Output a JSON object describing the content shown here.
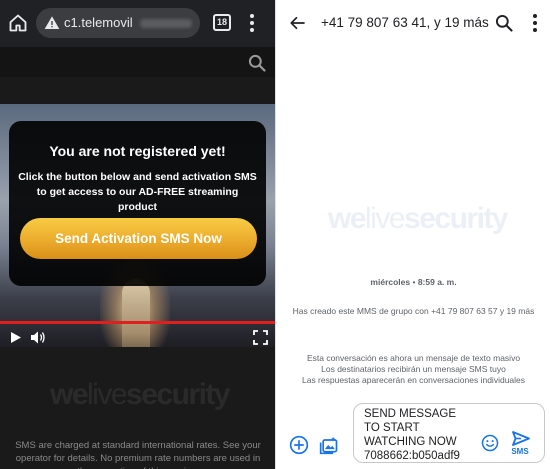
{
  "browser": {
    "url": "c1.telemovil",
    "tab_count": "18",
    "icons": {
      "home": "home-icon",
      "warning": "warning-icon",
      "menu": "more-vert-icon",
      "search": "search-icon"
    }
  },
  "modal": {
    "title": "You are not registered yet!",
    "body": "Click the button below and send activation SMS to get access to our AD-FREE streaming product",
    "button_label": "Send Activation SMS Now",
    "button_color": "#eaa82a"
  },
  "video": {
    "progress_color": "#e0201f",
    "icons": {
      "play": "play-icon",
      "volume": "volume-icon",
      "fullscreen": "fullscreen-icon"
    }
  },
  "disclaimer": "SMS are charged at standard international rates. See your operator for details. No premium rate numbers are used in the promotion of this service.",
  "watermark": "welivesecurity",
  "messages": {
    "title": "+41 79 807 63 41, y 19 más",
    "date_day": "miércoles",
    "date_time": "8:59 a. m.",
    "system_message_1": "Has creado este MMS de grupo con +41 79 807 63 57 y 19 más",
    "system_message_2_line1": "Esta conversación es ahora un mensaje de texto masivo",
    "system_message_2_line2": "Los destinatarios recibirán un mensaje SMS tuyo",
    "system_message_2_line3": "Las respuestas aparecerán en conversaciones individuales",
    "compose_text": "SEND MESSAGE\nTO START\nWATCHING NOW\n7088662:b050adf9",
    "send_label": "SMS",
    "accent_color": "#1a73e8",
    "icons": {
      "back": "arrow-back-icon",
      "search": "search-icon",
      "menu": "more-vert-icon",
      "add": "add-circle-icon",
      "gallery": "gallery-icon",
      "emoji": "emoji-icon",
      "send": "send-icon"
    }
  }
}
